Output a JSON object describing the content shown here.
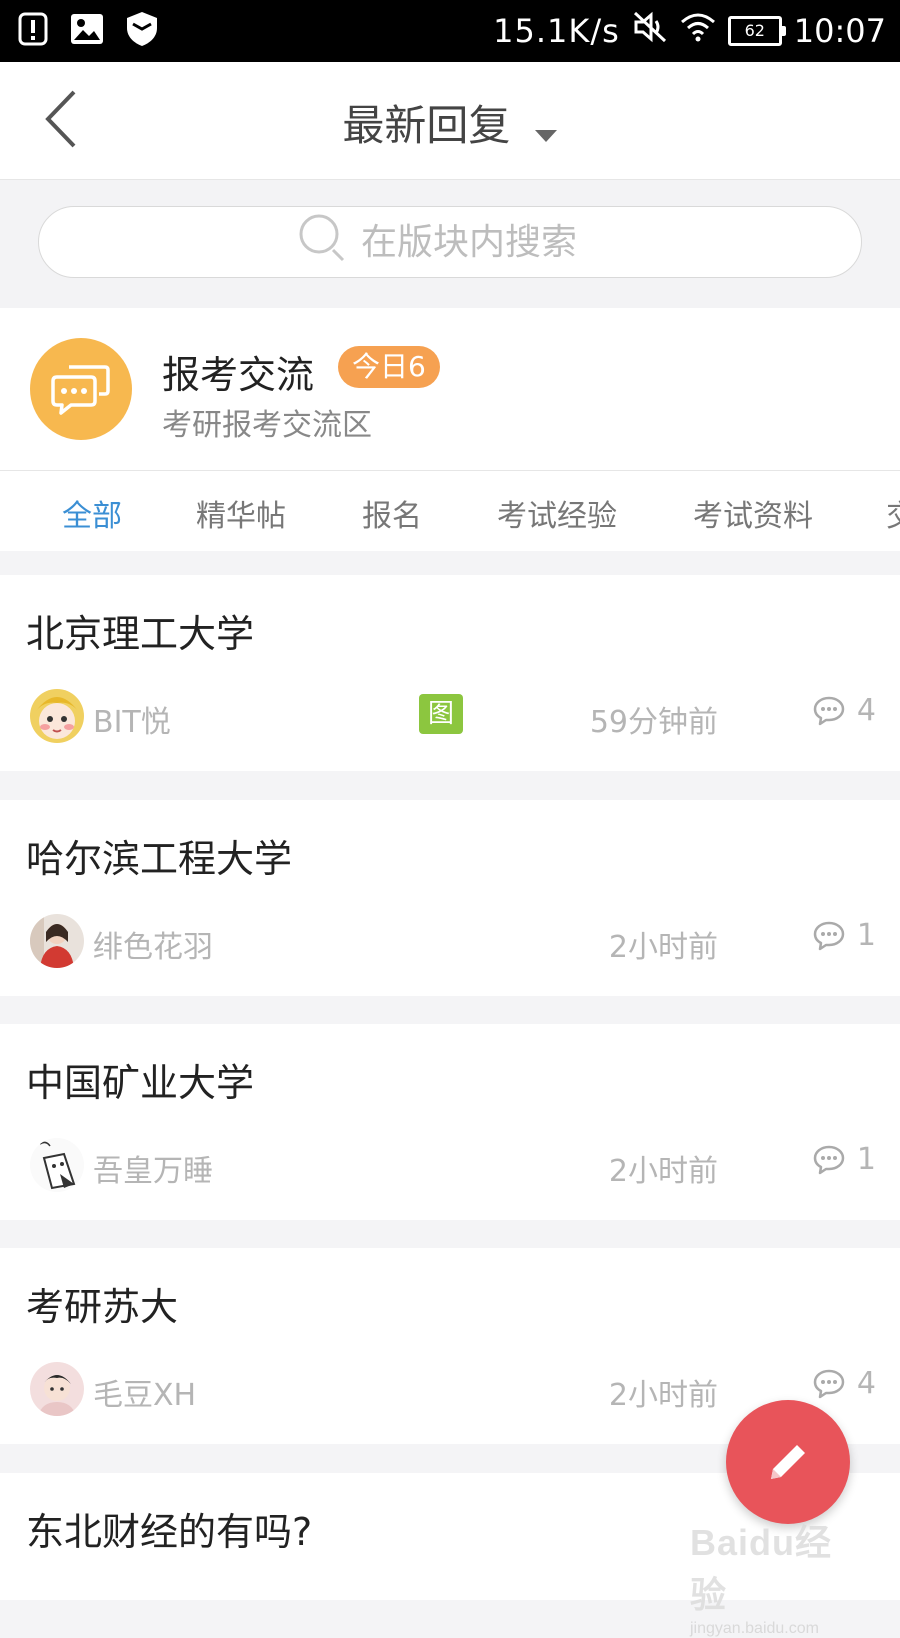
{
  "status_bar": {
    "net_speed": "15.1K/s",
    "battery": "62",
    "time": "10:07"
  },
  "nav": {
    "title": "最新回复"
  },
  "search": {
    "placeholder": "在版块内搜索"
  },
  "forum": {
    "name": "报考交流",
    "today_badge": "今日6",
    "description": "考研报考交流区",
    "avatar_color": "#f7b84f"
  },
  "tabs": [
    {
      "label": "全部",
      "active": true
    },
    {
      "label": "精华帖",
      "active": false
    },
    {
      "label": "报名",
      "active": false
    },
    {
      "label": "考试经验",
      "active": false
    },
    {
      "label": "考试资料",
      "active": false
    },
    {
      "label": "交",
      "active": false
    }
  ],
  "posts": [
    {
      "title": "北京理工大学",
      "author": "BIT悦",
      "image_tag": "图",
      "time": "59分钟前",
      "replies": "4"
    },
    {
      "title": "哈尔滨工程大学",
      "author": "绯色花羽",
      "time": "2小时前",
      "replies": "1"
    },
    {
      "title": "中国矿业大学",
      "author": "吾皇万睡",
      "time": "2小时前",
      "replies": "1"
    },
    {
      "title": "考研苏大",
      "author": "毛豆XH",
      "time": "2小时前",
      "replies": "4"
    },
    {
      "title": "东北财经的有吗?"
    }
  ],
  "watermark": {
    "main": "Baidu经验",
    "sub": "jingyan.baidu.com"
  },
  "colors": {
    "accent_tab": "#3b8fd4",
    "badge": "#f6a151",
    "fab": "#e8545a",
    "image_tag": "#8cc63f"
  }
}
